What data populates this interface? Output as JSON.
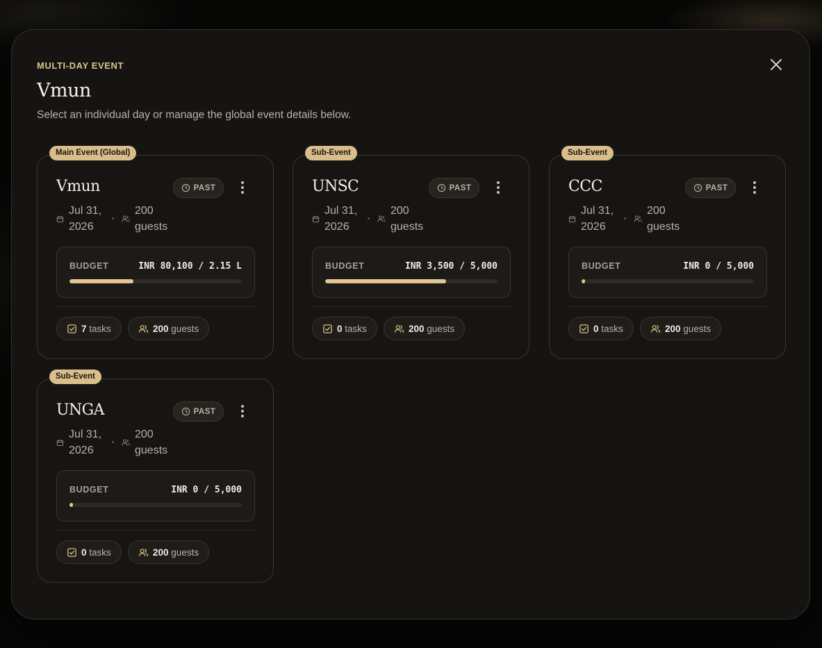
{
  "modal": {
    "eyebrow": "MULTI-DAY EVENT",
    "title": "Vmun",
    "subtitle": "Select an individual day or manage the global event details below."
  },
  "colors": {
    "accent": "#d9be8b",
    "background": "#151412",
    "progress": "#e1c893"
  },
  "cards": [
    {
      "tag": "Main Event (Global)",
      "name": "Vmun",
      "status": "PAST",
      "date": "Jul 31, 2026",
      "guests_meta": "200 guests",
      "budget_label": "BUDGET",
      "budget_value": "INR 80,100 / 2.15 L",
      "budget_progress": 0.37,
      "tasks_count": "7",
      "tasks_label": "tasks",
      "guests_count": "200",
      "guests_label": "guests"
    },
    {
      "tag": "Sub-Event",
      "name": "UNSC",
      "status": "PAST",
      "date": "Jul 31, 2026",
      "guests_meta": "200 guests",
      "budget_label": "BUDGET",
      "budget_value": "INR 3,500 / 5,000",
      "budget_progress": 0.7,
      "tasks_count": "0",
      "tasks_label": "tasks",
      "guests_count": "200",
      "guests_label": "guests"
    },
    {
      "tag": "Sub-Event",
      "name": "CCC",
      "status": "PAST",
      "date": "Jul 31, 2026",
      "guests_meta": "200 guests",
      "budget_label": "BUDGET",
      "budget_value": "INR 0 / 5,000",
      "budget_progress": 0.0,
      "tasks_count": "0",
      "tasks_label": "tasks",
      "guests_count": "200",
      "guests_label": "guests"
    },
    {
      "tag": "Sub-Event",
      "name": "UNGA",
      "status": "PAST",
      "date": "Jul 31, 2026",
      "guests_meta": "200 guests",
      "budget_label": "BUDGET",
      "budget_value": "INR 0 / 5,000",
      "budget_progress": 0.0,
      "tasks_count": "0",
      "tasks_label": "tasks",
      "guests_count": "200",
      "guests_label": "guests"
    }
  ]
}
